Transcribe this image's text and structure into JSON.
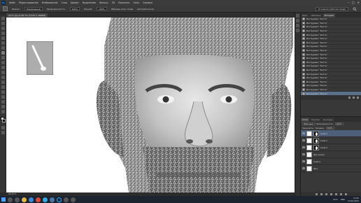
{
  "menubar": {
    "logo": "Ps",
    "items": [
      "Файл",
      "Редактирование",
      "Изображение",
      "Слои",
      "Шрифт",
      "Выделение",
      "Фильтр",
      "3D",
      "Просмотр",
      "Окно",
      "Справка"
    ]
  },
  "window_controls": [
    "–",
    "□",
    "×"
  ],
  "options": {
    "mode_label": "Режим:",
    "mode_value": "Нормальный",
    "opacity_label": "Непрозрачность:",
    "opacity_value": "100%",
    "flow_label": "Нажим:",
    "flow_value": "100%",
    "sample_all_label": "Образец всех слоев",
    "auto_enhance_label": "Автоматически",
    "workspace_label": "Основная рабочая среда"
  },
  "document_tab": "фото.jpg @ 66,7% (Слой 2, RGB/8)",
  "status_text": "66,67%",
  "history": {
    "tabs": [
      "Цвет",
      "Образцы",
      "История"
    ],
    "active_tab_index": 2,
    "items": [
      "Инструмент \"Кисть\"",
      "Инструмент \"Кисть\"",
      "Инструмент \"Кисть\"",
      "Инструмент \"Кисть\"",
      "Инструмент \"Кисть\"",
      "Инструмент \"Кисть\"",
      "Инструмент \"Кисть\"",
      "Инструмент \"Кисть\"",
      "Инструмент \"Кисть\"",
      "Инструмент \"Кисть\"",
      "Инструмент \"Кисть\"",
      "Инструмент \"Кисть\"",
      "Инструмент \"Кисть\"",
      "Инструмент \"Кисть\"",
      "Инструмент \"Кисть\"",
      "Инструмент \"Кисть\"",
      "Инструмент \"Кисть\"",
      "Инструмент \"Кисть\"",
      "Инструмент \"Кисть\"",
      "Инструмент \"Кисть\""
    ],
    "active_index": 19
  },
  "layers": {
    "tabs": [
      "Слои",
      "Каналы",
      "Контуры"
    ],
    "active_tab_index": 0,
    "blend_mode": "Обычные",
    "opacity_label": "Непрозрачность:",
    "opacity_value": "100%",
    "lock_label": "Закрепить:",
    "fill_label": "Заливка:",
    "fill_value": "100%",
    "items": [
      {
        "name": "Слой 2",
        "mask": true,
        "active": true
      },
      {
        "name": "Слой 1",
        "mask": true,
        "active": false
      },
      {
        "name": "Слой 3",
        "mask": true,
        "active": false
      },
      {
        "name": "Фон копия",
        "mask": false,
        "active": false
      },
      {
        "name": "Слой 4",
        "mask": false,
        "active": false
      },
      {
        "name": "Фон",
        "mask": false,
        "active": false
      }
    ]
  },
  "taskbar": {
    "weather": "16°C",
    "language": "ENG",
    "time": "13:45",
    "date": "13.09.2021"
  },
  "colors": {
    "accent": "#31a8ff",
    "history_active": "#5a6f8a",
    "layer_active": "#4d5f79"
  }
}
